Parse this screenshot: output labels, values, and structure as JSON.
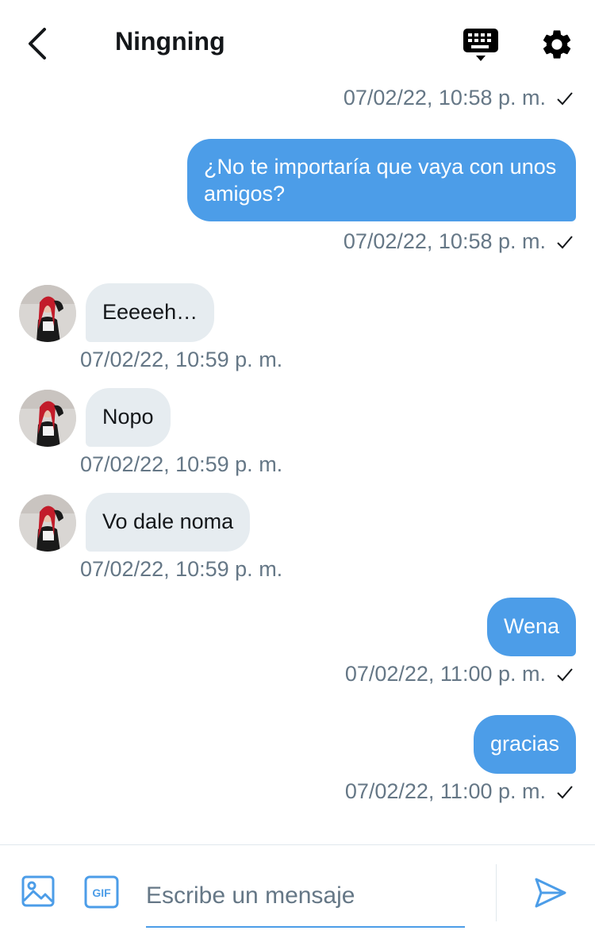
{
  "header": {
    "back_icon": "chevron-left-icon",
    "title": "Ningning",
    "keyboard_icon": "keyboard-icon",
    "settings_icon": "gear-icon"
  },
  "messages": [
    {
      "direction": "outgoing",
      "text": "",
      "timestamp": "07/02/22, 10:58 p. m.",
      "read_icon": "check-icon"
    },
    {
      "direction": "outgoing",
      "text": "¿No te importaría que vaya con unos amigos?",
      "timestamp": "07/02/22, 10:58 p. m.",
      "read_icon": "check-icon"
    },
    {
      "direction": "incoming",
      "text": "Eeeeeh…",
      "timestamp": "07/02/22, 10:59 p. m."
    },
    {
      "direction": "incoming",
      "text": "Nopo",
      "timestamp": "07/02/22, 10:59 p. m."
    },
    {
      "direction": "incoming",
      "text": "Vo dale noma",
      "timestamp": "07/02/22, 10:59 p. m."
    },
    {
      "direction": "outgoing",
      "text": "Wena",
      "timestamp": "07/02/22, 11:00 p. m.",
      "read_icon": "check-icon"
    },
    {
      "direction": "outgoing",
      "text": "gracias",
      "timestamp": "07/02/22, 11:00 p. m.",
      "read_icon": "check-icon"
    }
  ],
  "composer": {
    "media_icon": "image-icon",
    "gif_label": "GIF",
    "placeholder": "Escribe un mensaje",
    "value": "",
    "send_icon": "send-icon"
  },
  "colors": {
    "accent": "#4c9de8",
    "incoming_bubble": "#e6ecf0",
    "secondary_text": "#657786"
  }
}
